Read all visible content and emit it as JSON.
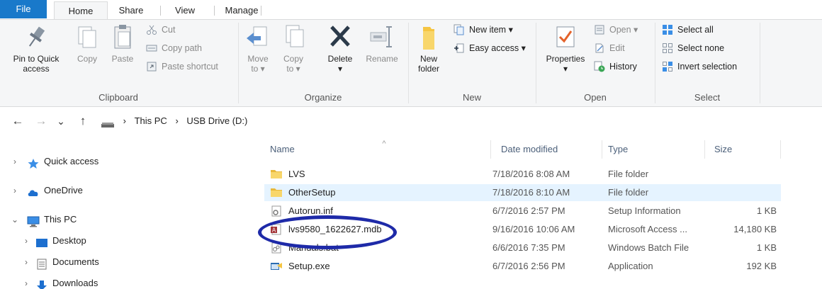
{
  "ribbon_tabs": [
    "File",
    "Home",
    "Share",
    "View",
    "Manage"
  ],
  "clipboard": {
    "pin_label": [
      "Pin to Quick",
      "access"
    ],
    "copy_label": "Copy",
    "paste_label": "Paste",
    "cut_label": "Cut",
    "copy_path_label": "Copy path",
    "paste_shortcut_label": "Paste shortcut",
    "group_label": "Clipboard"
  },
  "organize": {
    "move_to_label": [
      "Move",
      "to ▾"
    ],
    "copy_to_label": [
      "Copy",
      "to ▾"
    ],
    "delete_label": [
      "Delete",
      "▾"
    ],
    "rename_label": "Rename",
    "group_label": "Organize"
  },
  "new_group": {
    "new_folder_label": [
      "New",
      "folder"
    ],
    "new_item_label": "New item ▾",
    "easy_access_label": "Easy access ▾",
    "group_label": "New"
  },
  "open_group": {
    "properties_label": [
      "Properties",
      "▾"
    ],
    "open_label": "Open ▾",
    "edit_label": "Edit",
    "history_label": "History",
    "group_label": "Open"
  },
  "select_group": {
    "select_all_label": "Select all",
    "select_none_label": "Select none",
    "invert_selection_label": "Invert selection",
    "group_label": "Select"
  },
  "address": {
    "back_icon": "←",
    "forward_icon": "→",
    "recent_icon": "⌄",
    "up_icon": "↑",
    "crumb_sep": "›",
    "crumbs": [
      "This PC",
      "USB Drive (D:)"
    ]
  },
  "nav": {
    "quick_access": "Quick access",
    "onedrive": "OneDrive",
    "this_pc": "This PC",
    "desktop": "Desktop",
    "documents": "Documents",
    "downloads": "Downloads"
  },
  "columns": {
    "name": "Name",
    "date_modified": "Date modified",
    "type": "Type",
    "size": "Size",
    "sort_indicator": "^"
  },
  "files": [
    {
      "name": "LVS",
      "date": "7/18/2016 8:08 AM",
      "type": "File folder",
      "size": "",
      "icon": "folder-icon"
    },
    {
      "name": "OtherSetup",
      "date": "7/18/2016 8:10 AM",
      "type": "File folder",
      "size": "",
      "icon": "folder-icon"
    },
    {
      "name": "Autorun.inf",
      "date": "6/7/2016 2:57 PM",
      "type": "Setup Information",
      "size": "1 KB",
      "icon": "gear-file-icon"
    },
    {
      "name": "lvs9580_1622627.mdb",
      "date": "9/16/2016 10:06 AM",
      "type": "Microsoft Access ...",
      "size": "14,180 KB",
      "icon": "access-db-icon"
    },
    {
      "name": "Manuals.bat",
      "date": "6/6/2016 7:35 PM",
      "type": "Windows Batch File",
      "size": "1 KB",
      "icon": "batch-file-icon"
    },
    {
      "name": "Setup.exe",
      "date": "6/7/2016 2:56 PM",
      "type": "Application",
      "size": "192 KB",
      "icon": "setup-exe-icon"
    }
  ],
  "colors": {
    "accent": "#1979ca",
    "selection": "#e5f3ff",
    "annotation_circle": "#1e2aa8"
  }
}
